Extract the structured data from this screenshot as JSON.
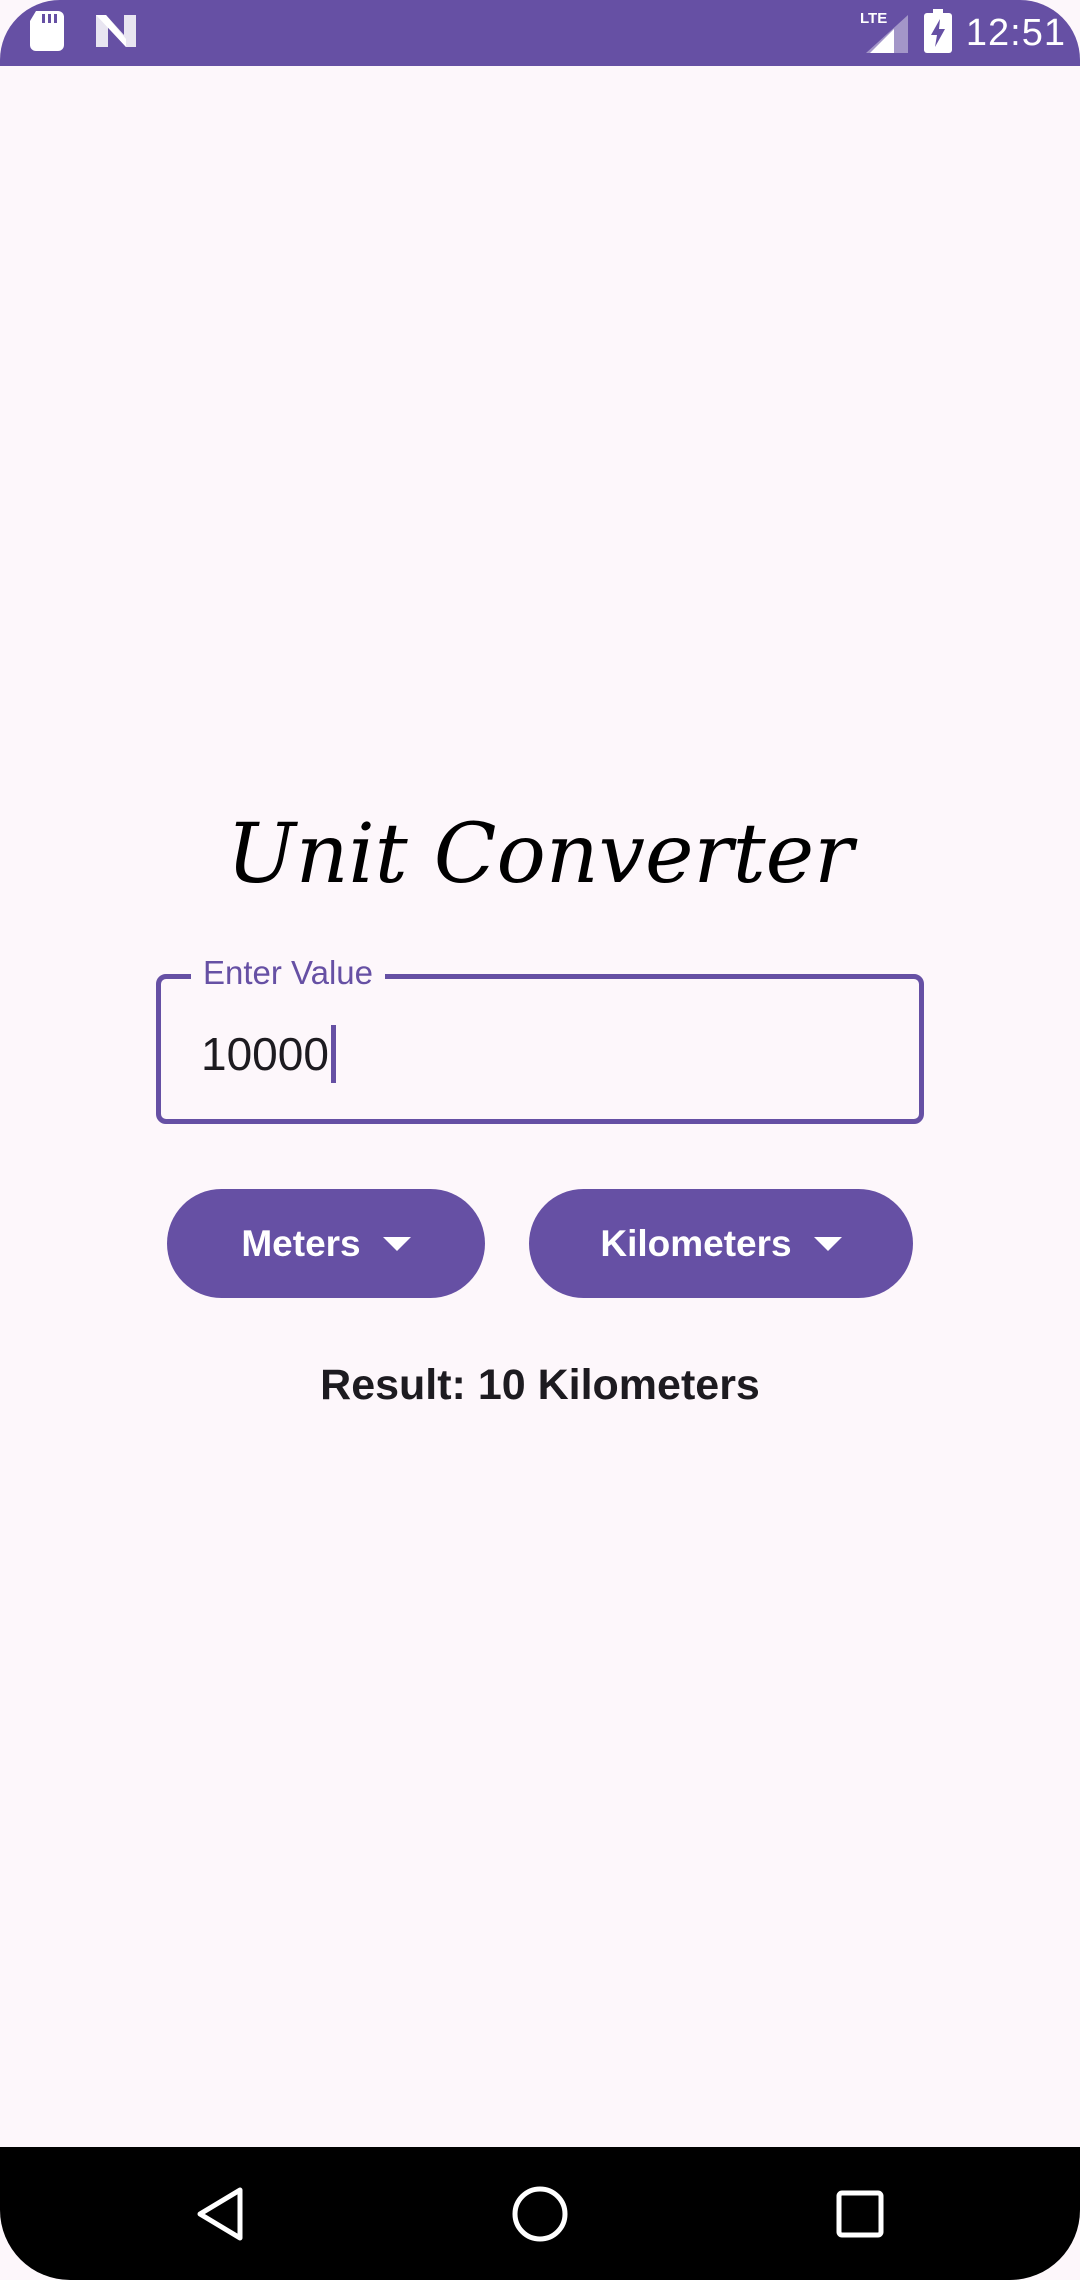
{
  "status_bar": {
    "time": "12:51",
    "network_label": "LTE",
    "icons": [
      "sd-card-icon",
      "n-logo-icon",
      "signal-icon",
      "battery-charging-icon"
    ]
  },
  "app": {
    "title": "Unit Converter"
  },
  "input": {
    "label": "Enter Value",
    "value": "10000"
  },
  "from_unit": {
    "selected": "Meters"
  },
  "to_unit": {
    "selected": "Kilometers"
  },
  "result": {
    "text": "Result: 10 Kilometers"
  },
  "navigation": {
    "icons": [
      "back-icon",
      "home-icon",
      "recents-icon"
    ]
  },
  "colors": {
    "primary": "#6650a4",
    "background": "#fdf7fb",
    "text": "#1d1b20"
  }
}
